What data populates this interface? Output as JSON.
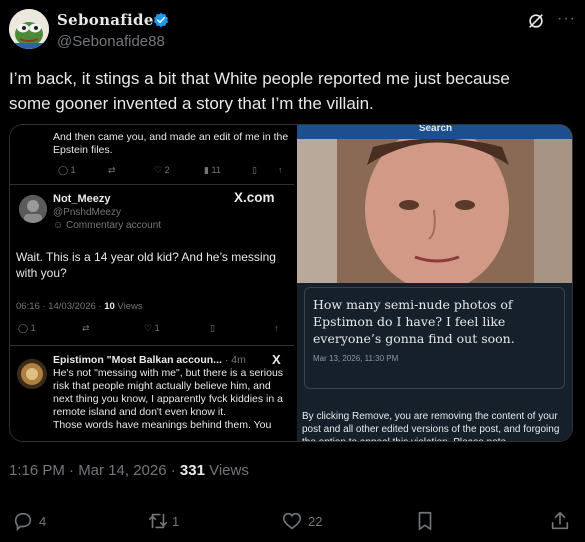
{
  "author": {
    "display_name": "Sebonafide",
    "handle": "@Sebonafide88"
  },
  "tweet": {
    "line1": "I’m back, it stings a bit that White people reported me just because",
    "line2": "some gooner invented a story that  I’m the villain.",
    "time": "1:16 PM · Mar 14, 2026 · ",
    "views_count": "331",
    "views_label": " Views"
  },
  "actions": {
    "replies": "4",
    "reposts": "1",
    "likes": "22"
  },
  "embedded_left": {
    "top_text": "And then came you, and made an edit of me in the Epstein files.",
    "top_actions": [
      "1",
      "2",
      "11"
    ],
    "reply_author": "Not_Meezy",
    "reply_handle": "@PnshdMeezy",
    "reply_community": "Commentary account",
    "reply_source": "X.com",
    "reply_text": "Wait. This is a 14 year old kid? And he’s messing with you?",
    "reply_time": "06:16 · 14/03/2026 · ",
    "reply_views_count": "10",
    "reply_views_label": " Views",
    "reply_actions": [
      "1",
      "1"
    ],
    "epi_author": "Epistimon \"Most Balkan accoun...",
    "epi_time": " · 4m",
    "epi_source": "X",
    "epi_text": "He's not \"messing with me\", but there is a serious risk that people might actually believe him, and next thing you know, I apparently fvck kiddies in a remote island and don't even know it.",
    "epi_text_cut": "Those words have meanings behind them. You"
  },
  "embedded_right": {
    "search_label": "Search",
    "card_text": "How many semi-nude photos of Epstimon do I have? I feel like everyone’s gonna find out soon.",
    "card_date": "Mar 13, 2026, 11:30 PM",
    "remove_text": "By clicking Remove, you are removing the content of your post and all other edited versions of the post, and forgoing the option to appeal this violation. Please note"
  },
  "colors": {
    "background": "#000000",
    "text": "#e7e9ea",
    "muted": "#71767b",
    "verified": "#1d9bf0",
    "card_bg": "#15202b"
  }
}
